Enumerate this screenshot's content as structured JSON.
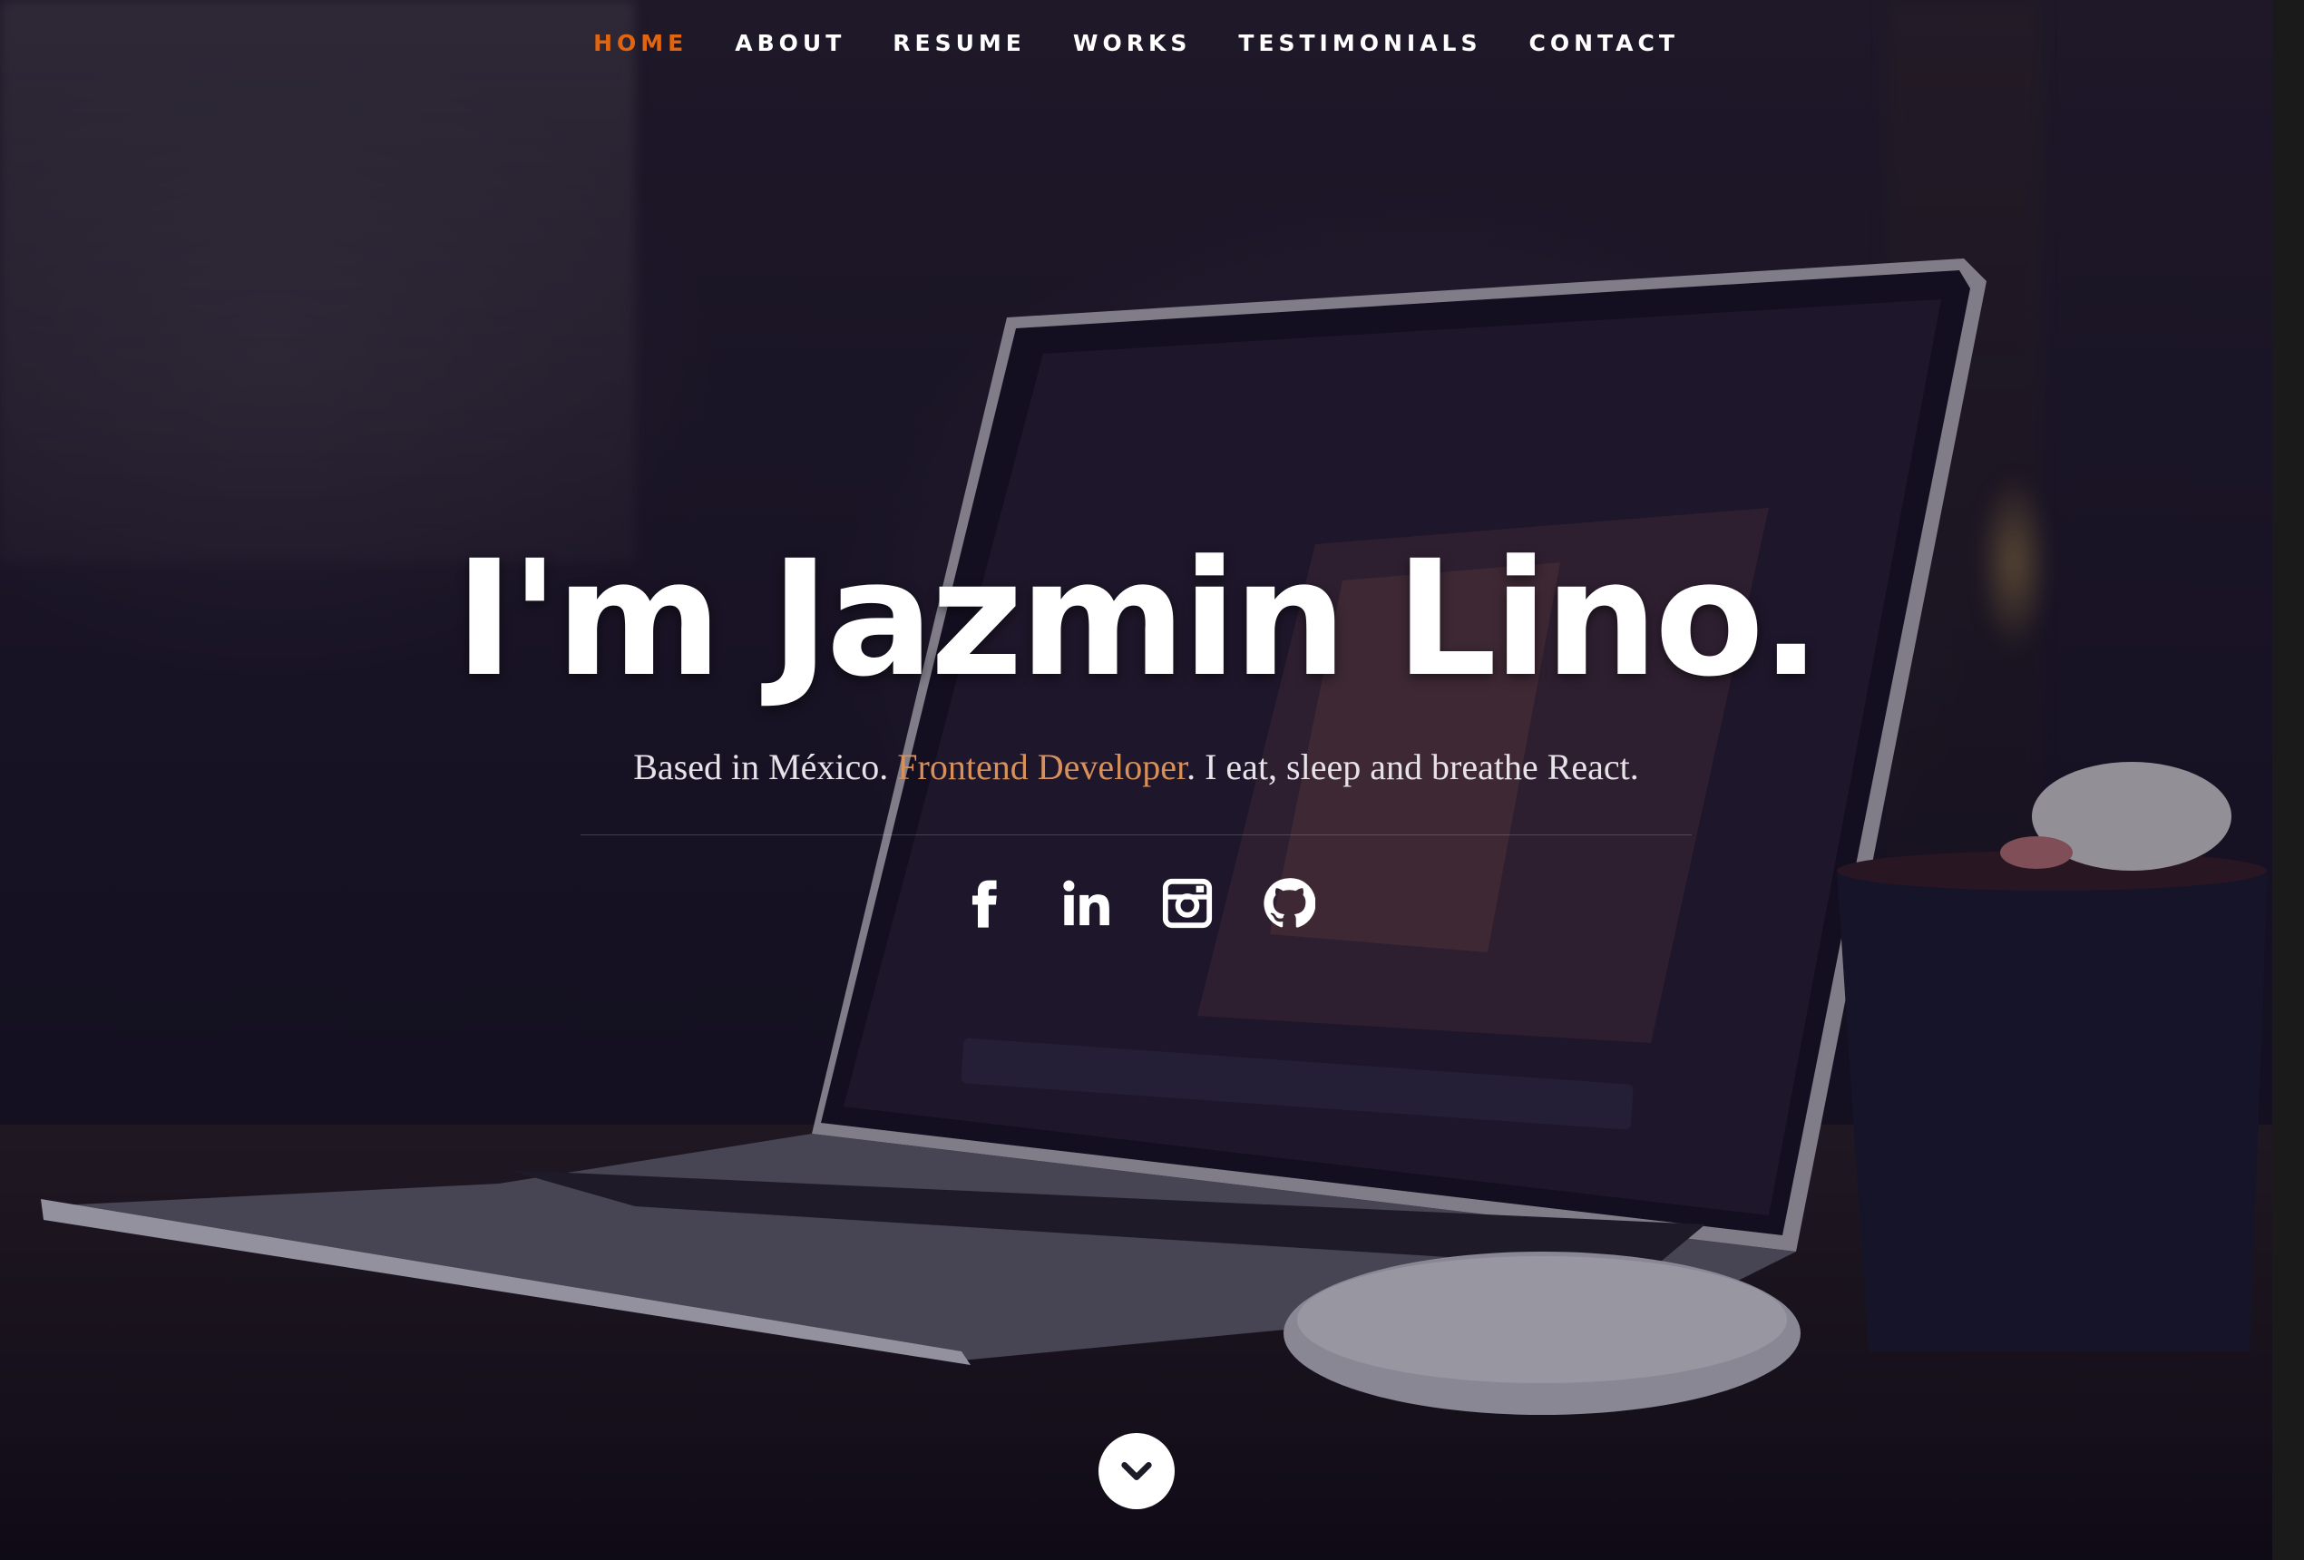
{
  "nav": {
    "items": [
      {
        "label": "HOME",
        "active": true
      },
      {
        "label": "ABOUT",
        "active": false
      },
      {
        "label": "RESUME",
        "active": false
      },
      {
        "label": "WORKS",
        "active": false
      },
      {
        "label": "TESTIMONIALS",
        "active": false
      },
      {
        "label": "CONTACT",
        "active": false
      }
    ],
    "active_color": "#e0650e"
  },
  "banner": {
    "headline": "I'm Jazmin Lino.",
    "sub_prefix": "Based in México. ",
    "sub_accent": "Frontend Developer",
    "sub_suffix": ". I eat, sleep and breathe React.",
    "accent_color": "#d8905a"
  },
  "socials": [
    {
      "icon": "facebook-icon"
    },
    {
      "icon": "linkedin-icon"
    },
    {
      "icon": "instagram-icon"
    },
    {
      "icon": "github-icon"
    }
  ],
  "scroll": {
    "icon": "chevron-down-icon"
  }
}
